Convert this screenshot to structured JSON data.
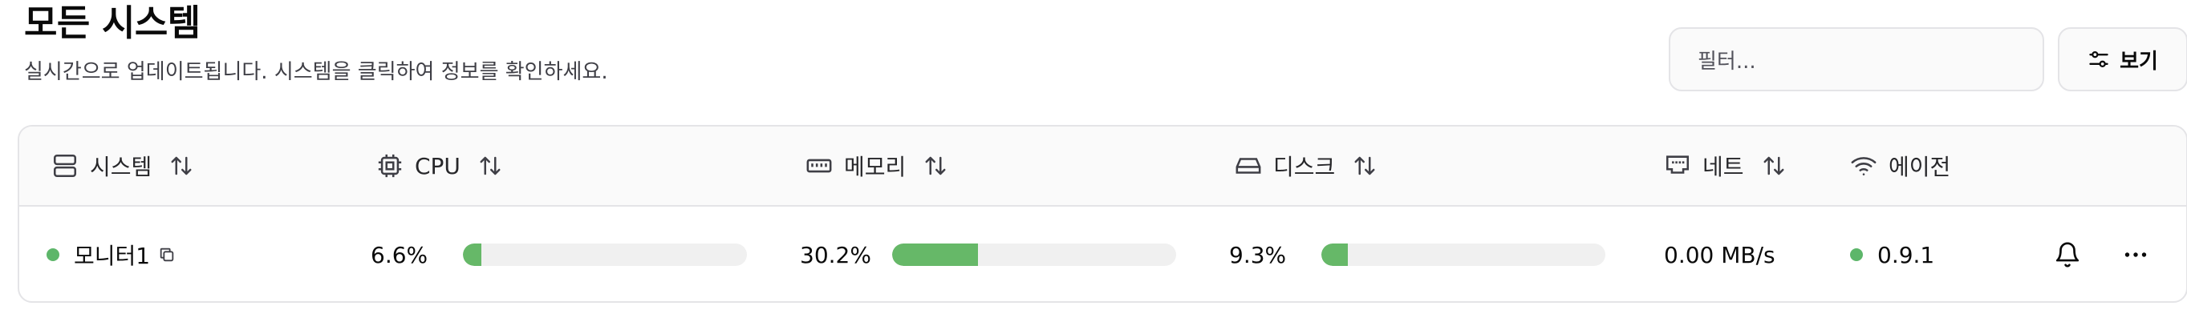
{
  "header": {
    "title": "모든 시스템",
    "subtitle": "실시간으로 업데이트됩니다. 시스템을 클릭하여 정보를 확인하세요."
  },
  "toolbar": {
    "filter_placeholder": "필터...",
    "view_label": "보기"
  },
  "table": {
    "columns": [
      "시스템",
      "CPU",
      "메모리",
      "디스크",
      "네트",
      "에이전"
    ],
    "rows": [
      {
        "system": "모니터1",
        "status_color": "#5db66a",
        "cpu": "6.6%",
        "cpu_fraction": 0.066,
        "memory": "30.2%",
        "memory_fraction": 0.302,
        "disk": "9.3%",
        "disk_fraction": 0.093,
        "net": "0.00 MB/s",
        "agent": "0.9.1"
      }
    ]
  },
  "colors": {
    "accent": "#5db66a",
    "track": "#f0f0f0",
    "border": "#e4e4e7"
  }
}
